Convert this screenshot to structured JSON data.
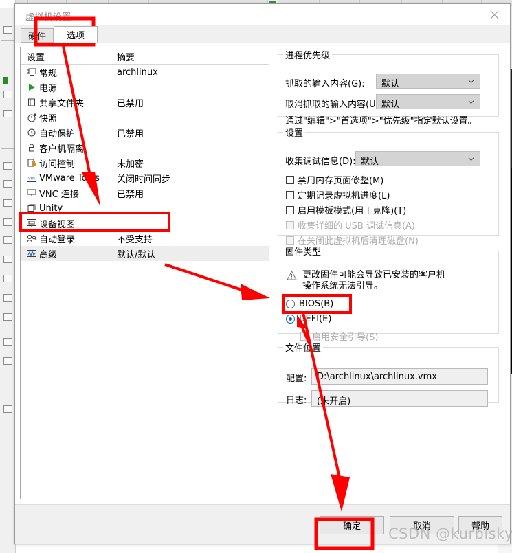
{
  "window": {
    "title": "虚拟机设置",
    "close_icon": "close-icon"
  },
  "tabs": [
    {
      "label": "硬件",
      "active": false
    },
    {
      "label": "选项",
      "active": true
    }
  ],
  "settings_list": {
    "headers": {
      "settings": "设置",
      "summary": "摘要"
    },
    "rows": [
      {
        "icon": "monitor-icon",
        "label": "常规",
        "summary": "archlinux"
      },
      {
        "icon": "play-triangle-icon",
        "label": "电源",
        "summary": ""
      },
      {
        "icon": "folder-share-icon",
        "label": "共享文件夹",
        "summary": "已禁用"
      },
      {
        "icon": "snapshot-clock-icon",
        "label": "快照",
        "summary": ""
      },
      {
        "icon": "clock-icon",
        "label": "自动保护",
        "summary": "已禁用"
      },
      {
        "icon": "lock-icon",
        "label": "客户机隔离",
        "summary": ""
      },
      {
        "icon": "access-lock-icon",
        "label": "访问控制",
        "summary": "未加密"
      },
      {
        "icon": "vm-tools-icon",
        "label": "VMware Tools",
        "summary": "关闭时间同步"
      },
      {
        "icon": "vnc-icon",
        "label": "VNC 连接",
        "summary": "已禁用"
      },
      {
        "icon": "unity-window-icon",
        "label": "Unity",
        "summary": ""
      },
      {
        "icon": "device-view-icon",
        "label": "设备视图",
        "summary": ""
      },
      {
        "icon": "auto-login-icon",
        "label": "自动登录",
        "summary": "不受支持"
      },
      {
        "icon": "advanced-wave-icon",
        "label": "高级",
        "summary": "默认/默认",
        "selected": true
      }
    ]
  },
  "process_priority": {
    "legend": "进程优先级",
    "grab_label": "抓取的输入内容(G):",
    "grab_value": "默认",
    "ungrab_label": "取消抓取的输入内容(U):",
    "ungrab_value": "默认",
    "hint": "通过\"编辑\">\"首选项\">\"优先级\"指定默认设置。"
  },
  "settings_group": {
    "legend": "设置",
    "debug_label": "收集调试信息(D):",
    "debug_value": "默认",
    "checkboxes": [
      {
        "label": "禁用内存页面修整(M)",
        "checked": false,
        "disabled": false
      },
      {
        "label": "定期记录虚拟机进度(L)",
        "checked": false,
        "disabled": false
      },
      {
        "label": "启用模板模式(用于克隆)(T)",
        "checked": false,
        "disabled": false
      },
      {
        "label": "收集详细的 USB 调试信息(A)",
        "checked": false,
        "disabled": true
      },
      {
        "label": "在关闭此虚拟机后清理磁盘(N)",
        "checked": false,
        "disabled": true
      }
    ]
  },
  "firmware": {
    "legend": "固件类型",
    "warning_icon": "warning-triangle-icon",
    "warning_text": "更改固件可能会导致已安装的客户机\n操作系统无法引导。",
    "options": [
      {
        "label": "BIOS(B)",
        "selected": false
      },
      {
        "label": "UEFI(E)",
        "selected": true
      }
    ],
    "secure_boot": {
      "label": "启用安全引导(S)",
      "checked": false,
      "disabled": true
    }
  },
  "file_location": {
    "legend": "文件位置",
    "config_label": "配置:",
    "config_value": "D:\\archlinux\\archlinux.vmx",
    "log_label": "日志:",
    "log_value": "(未开启)"
  },
  "footer": {
    "ok": "确定",
    "cancel": "取消",
    "help": "帮助"
  },
  "watermark": "CSDN @kurbisky",
  "colors": {
    "annotation": "#ff0000",
    "accent": "#0a66c2",
    "selected_row": "#ededed"
  }
}
